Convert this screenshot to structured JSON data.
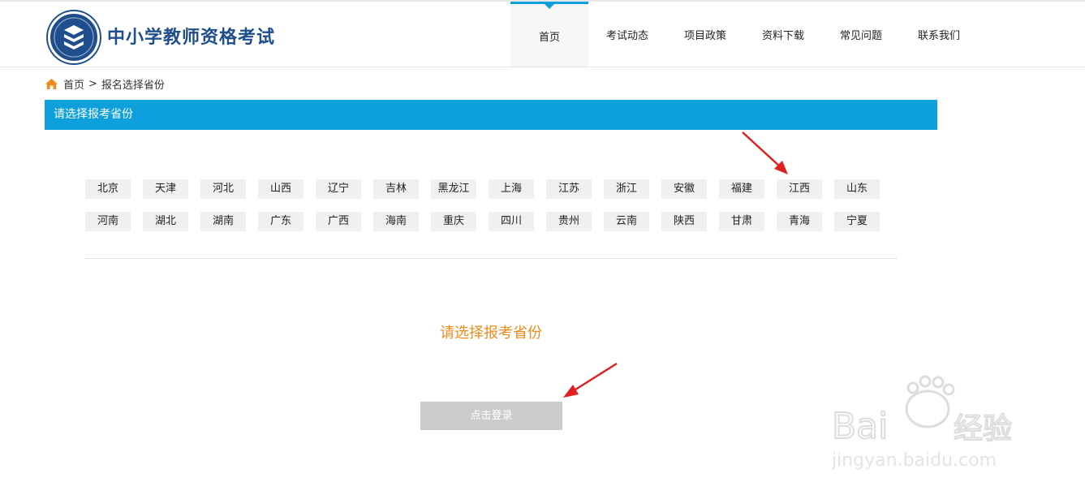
{
  "header": {
    "site_title": "中小学教师资格考试",
    "nav": [
      {
        "label": "首页",
        "active": true
      },
      {
        "label": "考试动态"
      },
      {
        "label": "项目政策"
      },
      {
        "label": "资料下载"
      },
      {
        "label": "常见问题"
      },
      {
        "label": "联系我们"
      }
    ]
  },
  "breadcrumb": {
    "home": "首页",
    "separator": ">",
    "current": "报名选择省份"
  },
  "section_title": "请选择报考省份",
  "provinces": {
    "row1": [
      "北京",
      "天津",
      "河北",
      "山西",
      "辽宁",
      "吉林",
      "黑龙江",
      "上海",
      "江苏",
      "浙江",
      "安徽",
      "福建",
      "江西",
      "山东"
    ],
    "row2": [
      "河南",
      "湖北",
      "湖南",
      "广东",
      "广西",
      "海南",
      "重庆",
      "四川",
      "贵州",
      "云南",
      "陕西",
      "甘肃",
      "青海",
      "宁夏"
    ]
  },
  "prompt": "请选择报考省份",
  "login_button": "点击登录",
  "colors": {
    "accent": "#0ea0dd",
    "prompt": "#f08a1c",
    "brand": "#1f4e8c",
    "annotation": "#e02020"
  }
}
